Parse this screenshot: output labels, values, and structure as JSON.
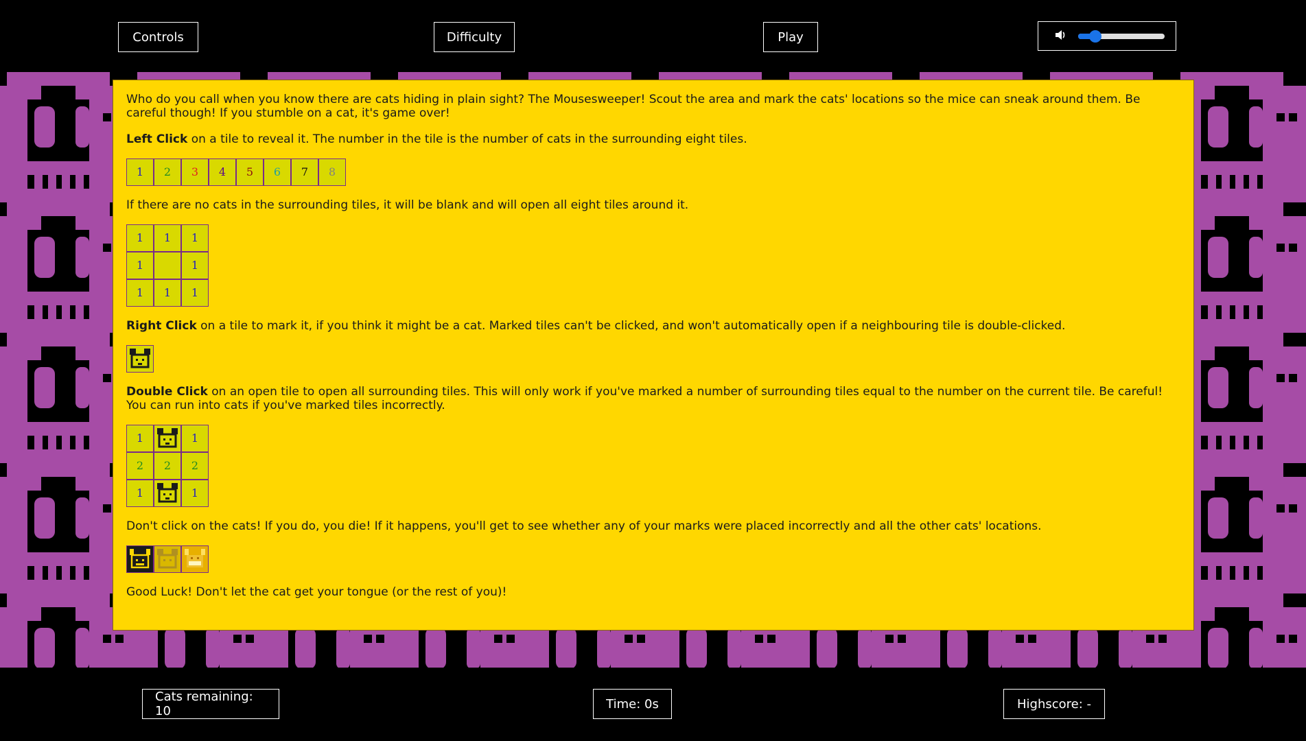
{
  "nav": {
    "controls": "Controls",
    "difficulty": "Difficulty",
    "play": "Play",
    "volume_level": 0.2
  },
  "colors": {
    "panel": "#ffd700",
    "tile": "#d9d900",
    "background_cats": "#a64ca6",
    "slider": "#1a73e8"
  },
  "instructions": {
    "intro": "Who do you call when you know there are cats hiding in plain sight? The Mousesweeper! Scout the area and mark the cats' locations so the mice can sneak around them. Be careful though! If you stumble on a cat, it's game over!",
    "left_click_label": "Left Click",
    "left_click_text": " on a tile to reveal it. The number in the tile is the number of cats in the surrounding eight tiles.",
    "number_tiles": [
      "1",
      "2",
      "3",
      "4",
      "5",
      "6",
      "7",
      "8"
    ],
    "blank_text": "If there are no cats in the surrounding tiles, it will be blank and will open all eight tiles around it.",
    "blank_grid": [
      "1",
      "1",
      "1",
      "1",
      "",
      "1",
      "1",
      "1",
      "1"
    ],
    "right_click_label": "Right Click",
    "right_click_text": " on a tile to mark it, if you think it might be a cat. Marked tiles can't be clicked, and won't automatically open if a neighbouring tile is double-clicked.",
    "double_click_label": "Double Click",
    "double_click_text": " on an open tile to open all surrounding tiles. This will only work if you've marked a number of surrounding tiles equal to the number on the current tile. Be careful! You can run into cats if you've marked tiles incorrectly.",
    "double_grid": [
      "1",
      "mouse",
      "1",
      "2",
      "2",
      "2",
      "1",
      "mouse",
      "1"
    ],
    "dead_text": "Don't click on the cats! If you do, you die! If it happens, you'll get to see whether any of your marks were placed incorrectly and all the other cats' locations.",
    "outro": "Good Luck! Don't let the cat get your tongue (or the rest of you)!"
  },
  "status": {
    "cats_remaining": "Cats remaining: 10",
    "time": "Time: 0s",
    "highscore": "Highscore: -"
  }
}
